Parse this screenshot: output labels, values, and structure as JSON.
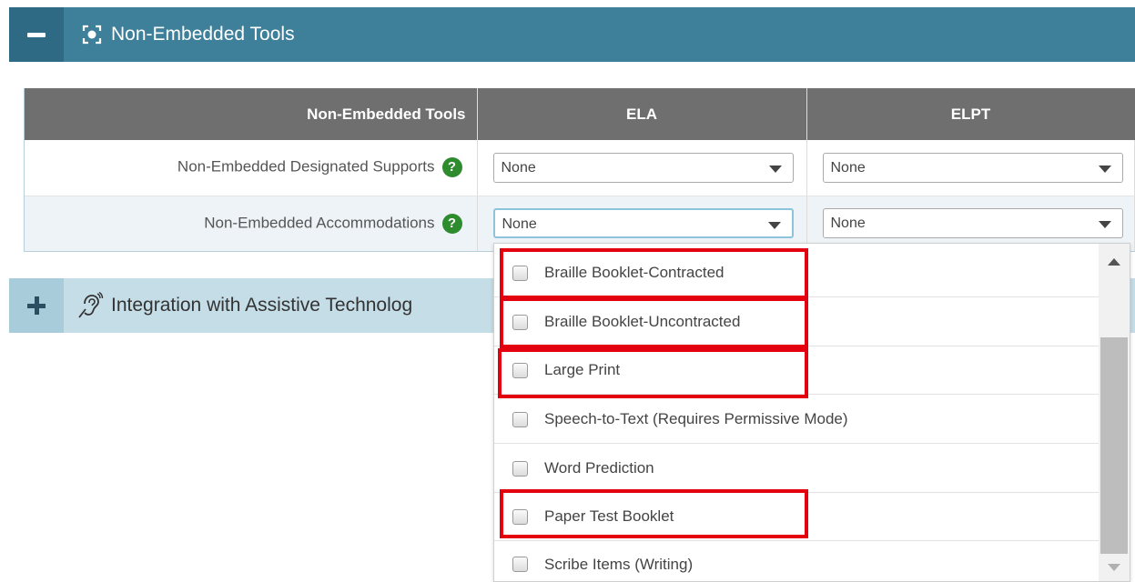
{
  "header": {
    "title": "Non-Embedded Tools",
    "accent": "#3e7f9a"
  },
  "table": {
    "columns": [
      "Non-Embedded Tools",
      "ELA",
      "ELPT"
    ],
    "rows": [
      {
        "label": "Non-Embedded Designated Supports",
        "ela_value": "None",
        "elpt_value": "None"
      },
      {
        "label": "Non-Embedded Accommodations",
        "ela_value": "None",
        "elpt_value": "None"
      }
    ],
    "help_glyph": "?"
  },
  "collapsed_section": {
    "title": "Integration with Assistive Technolog"
  },
  "dropdown": {
    "items": [
      {
        "label": "Braille Booklet-Contracted",
        "checked": false,
        "highlighted": true
      },
      {
        "label": "Braille Booklet-Uncontracted",
        "checked": false,
        "highlighted": true
      },
      {
        "label": "Large Print",
        "checked": false,
        "highlighted": true
      },
      {
        "label": "Speech-to-Text (Requires Permissive Mode)",
        "checked": false,
        "highlighted": false
      },
      {
        "label": "Word Prediction",
        "checked": false,
        "highlighted": false
      },
      {
        "label": "Paper Test Booklet",
        "checked": false,
        "highlighted": true
      },
      {
        "label": "Scribe Items (Writing)",
        "checked": false,
        "highlighted": false
      }
    ],
    "highlight_color": "#e3000f"
  }
}
